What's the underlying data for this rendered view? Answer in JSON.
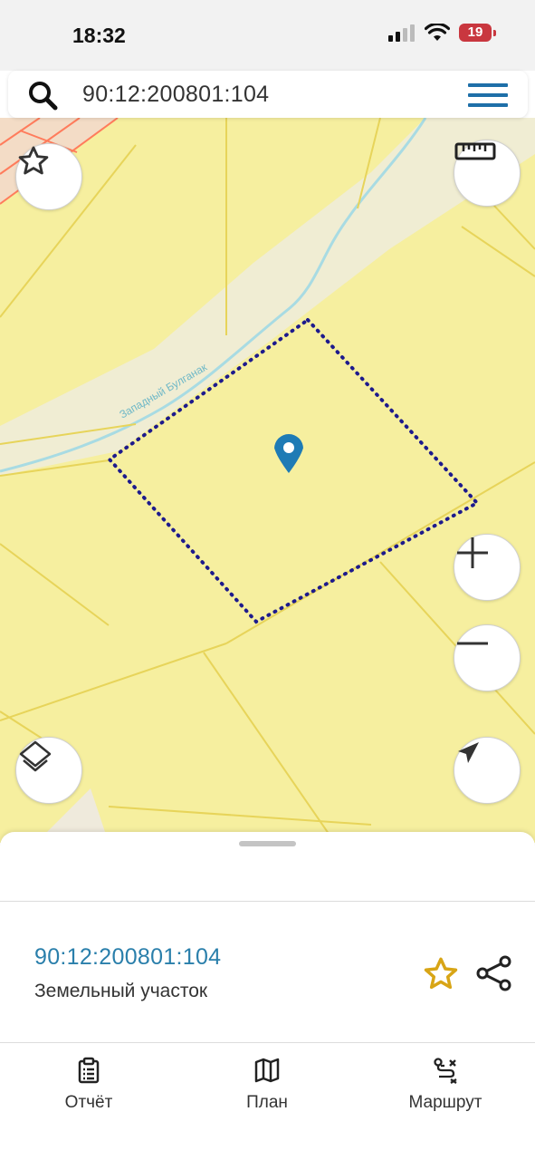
{
  "status_bar": {
    "time": "18:32",
    "battery_level": "19",
    "icons": [
      "signal-icon",
      "wifi-icon",
      "battery-icon"
    ]
  },
  "search": {
    "query": "90:12:200801:104",
    "icon": "search-icon",
    "menu_icon": "hamburger-menu-icon"
  },
  "map": {
    "stream_label": "Западный Булганак",
    "controls": [
      "favorite-star",
      "ruler",
      "zoom-in",
      "zoom-out",
      "layers",
      "my-location"
    ],
    "colors": {
      "land": "#f6ef9f",
      "parcel_border": "#1d1a8c",
      "pin": "#1e7bb5",
      "stream": "#a8dbe3"
    }
  },
  "sheet": {
    "parcel_id": "90:12:200801:104",
    "parcel_type": "Земельный участок"
  },
  "tabs": [
    {
      "label": "Отчёт",
      "icon": "report-icon"
    },
    {
      "label": "План",
      "icon": "map-icon"
    },
    {
      "label": "Маршрут",
      "icon": "route-icon"
    }
  ]
}
